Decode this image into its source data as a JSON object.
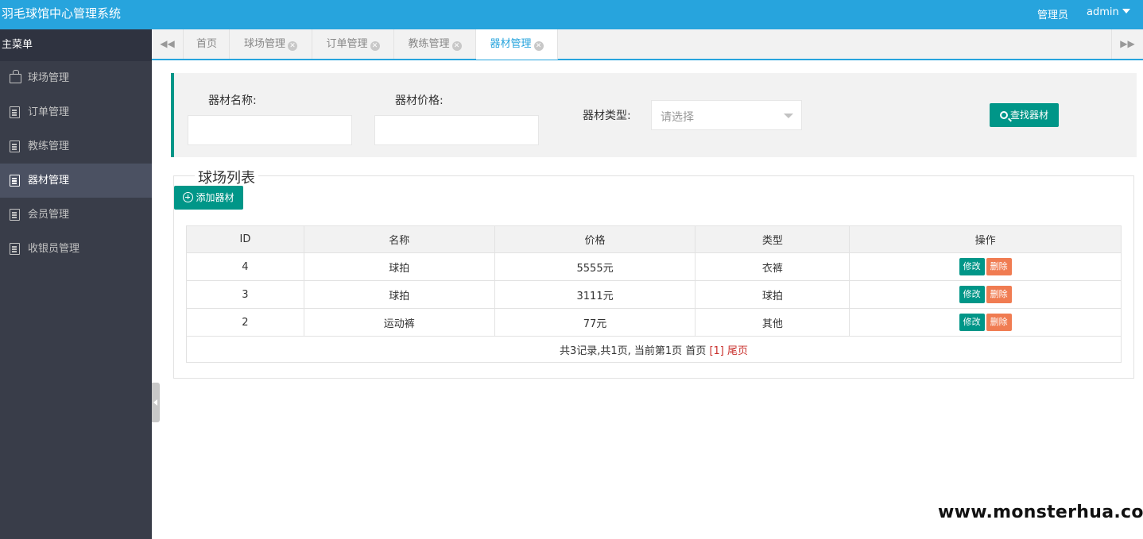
{
  "header": {
    "app_title": "羽毛球馆中心管理系统",
    "role": "管理员",
    "user": "admin"
  },
  "sidebar": {
    "heading": "主菜单",
    "items": [
      {
        "label": "球场管理",
        "icon": "bag-icon"
      },
      {
        "label": "订单管理",
        "icon": "document-icon"
      },
      {
        "label": "教练管理",
        "icon": "document-icon"
      },
      {
        "label": "器材管理",
        "icon": "document-icon",
        "active": true
      },
      {
        "label": "会员管理",
        "icon": "document-icon"
      },
      {
        "label": "收银员管理",
        "icon": "document-icon"
      }
    ]
  },
  "tabs": [
    {
      "label": "首页",
      "closable": false
    },
    {
      "label": "球场管理",
      "closable": true
    },
    {
      "label": "订单管理",
      "closable": true
    },
    {
      "label": "教练管理",
      "closable": true
    },
    {
      "label": "器材管理",
      "closable": true,
      "active": true
    }
  ],
  "search": {
    "name_label": "器材名称:",
    "name_value": "",
    "price_label": "器材价格:",
    "price_value": "",
    "type_label": "器材类型:",
    "type_placeholder": "请选择",
    "search_button": "查找器材"
  },
  "list": {
    "legend": "球场列表",
    "add_button": "添加器材",
    "columns": [
      "ID",
      "名称",
      "价格",
      "类型",
      "操作"
    ],
    "rows": [
      {
        "id": "4",
        "name": "球拍",
        "price": "5555元",
        "type": "衣裤"
      },
      {
        "id": "3",
        "name": "球拍",
        "price": "3111元",
        "type": "球拍"
      },
      {
        "id": "2",
        "name": "运动裤",
        "price": "77元",
        "type": "其他"
      }
    ],
    "edit_label": "修改",
    "delete_label": "删除",
    "pager": {
      "summary": "共3记录,共1页, 当前第1页",
      "first": "首页",
      "current": "[1]",
      "last": "尾页"
    }
  },
  "watermark": "www.monsterhua.com",
  "colors": {
    "header": "#27a4dd",
    "sidebar": "#393d49",
    "accent_teal": "#009688",
    "danger": "#f07c52"
  }
}
